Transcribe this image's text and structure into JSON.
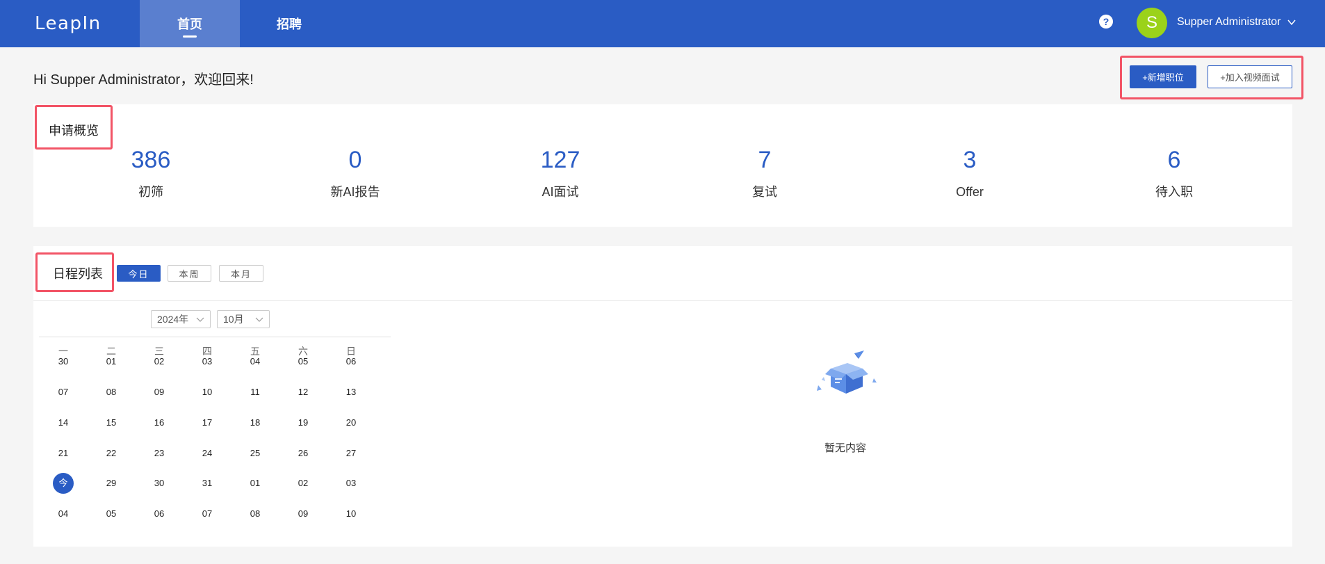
{
  "header": {
    "logo": "LeapIn",
    "tabs": [
      {
        "label": "首页"
      },
      {
        "label": "招聘"
      }
    ],
    "help_label": "?",
    "avatar_letter": "S",
    "user_name": "Supper Administrator"
  },
  "welcome": {
    "text": "Hi Supper Administrator，欢迎回来!",
    "add_position_label": "+新增职位",
    "join_interview_label": "+加入视频面试"
  },
  "overview": {
    "title": "申请概览",
    "stats": [
      {
        "value": "386",
        "label": "初筛"
      },
      {
        "value": "0",
        "label": "新AI报告"
      },
      {
        "value": "127",
        "label": "AI面试"
      },
      {
        "value": "7",
        "label": "复试"
      },
      {
        "value": "3",
        "label": "Offer"
      },
      {
        "value": "6",
        "label": "待入职"
      }
    ]
  },
  "schedule": {
    "title": "日程列表",
    "segments": [
      {
        "label": "今日"
      },
      {
        "label": "本周"
      },
      {
        "label": "本月"
      }
    ],
    "year_select": "2024年",
    "month_select": "10月",
    "weekdays": [
      "一",
      "二",
      "三",
      "四",
      "五",
      "六",
      "日"
    ],
    "weeks": [
      [
        "30",
        "01",
        "02",
        "03",
        "04",
        "05",
        "06"
      ],
      [
        "07",
        "08",
        "09",
        "10",
        "11",
        "12",
        "13"
      ],
      [
        "14",
        "15",
        "16",
        "17",
        "18",
        "19",
        "20"
      ],
      [
        "21",
        "22",
        "23",
        "24",
        "25",
        "26",
        "27"
      ],
      [
        "今",
        "29",
        "30",
        "31",
        "01",
        "02",
        "03"
      ],
      [
        "04",
        "05",
        "06",
        "07",
        "08",
        "09",
        "10"
      ]
    ],
    "empty_text": "暂无内容"
  },
  "colors": {
    "brand": "#2a5cc4",
    "avatar": "#9bd21a",
    "highlight": "#f25466"
  }
}
